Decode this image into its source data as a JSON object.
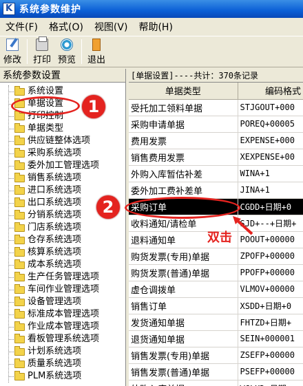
{
  "window": {
    "title": "系统参数维护",
    "icon_label": "K"
  },
  "menu": [
    {
      "label": "文件(F)"
    },
    {
      "label": "格式(O)"
    },
    {
      "label": "视图(V)"
    },
    {
      "label": "帮助(H)"
    }
  ],
  "toolbar": [
    {
      "label": "修改",
      "icon": "edit-icon"
    },
    {
      "label": "打印",
      "icon": "print-icon"
    },
    {
      "label": "预览",
      "icon": "preview-icon"
    },
    {
      "label": "退出",
      "icon": "exit-icon"
    }
  ],
  "tree": {
    "header": "系统参数设置",
    "items": [
      "系统设置",
      "单据设置",
      "打印控制",
      "单据类型",
      "供应链整体选项",
      "采购系统选项",
      "委外加工管理选项",
      "销售系统选项",
      "进口系统选项",
      "出口系统选项",
      "分销系统选项",
      "门店系统选项",
      "仓存系统选项",
      "核算系统选项",
      "成本系统选项",
      "生产任务管理选项",
      "车间作业管理选项",
      "设备管理选项",
      "标准成本管理选项",
      "作业成本管理选项",
      "看板管理系统选项",
      "计划系统选项",
      "质量系统选项",
      "PLM系统选项"
    ]
  },
  "grid": {
    "summary": "[单据设置]----共计：370条记录",
    "columns": [
      "单据类型",
      "编码格式"
    ],
    "rows": [
      [
        "受托加工领料单据",
        "STJGOUT+000"
      ],
      [
        "采购申请单据",
        "POREQ+00005"
      ],
      [
        "费用发票",
        "EXPENSE+000"
      ],
      [
        "销售费用发票",
        "XEXPENSE+00"
      ],
      [
        "外购入库暂估补差",
        "WINA+1"
      ],
      [
        "委外加工费补差单",
        "JINA+1"
      ],
      [
        "采购订单",
        "CGDD+日期+0"
      ],
      [
        "收料通知/请检单",
        "SJD+--+日期+"
      ],
      [
        "退料通知单",
        "POOUT+00000"
      ],
      [
        "购货发票(专用)单据",
        "ZPOFP+00000"
      ],
      [
        "购货发票(普通)单据",
        "PPOFP+00000"
      ],
      [
        "虚仓调拨单",
        "VLMOV+00000"
      ],
      [
        "销售订单",
        "XSDD+日期+0"
      ],
      [
        "发货通知单据",
        "FHTZD+日期+"
      ],
      [
        "退货通知单据",
        "SEIN+000001"
      ],
      [
        "销售发票(专用)单据",
        "ZSEFP+00000"
      ],
      [
        "销售发票(普通)单据",
        "PSEFP+00000"
      ],
      [
        "外购入库单据",
        "WGLKD+日期+"
      ]
    ],
    "selected_row": 6
  },
  "annotations": {
    "step1": "1",
    "step2": "2",
    "double_click": "双击",
    "accent": "#e4231f"
  }
}
